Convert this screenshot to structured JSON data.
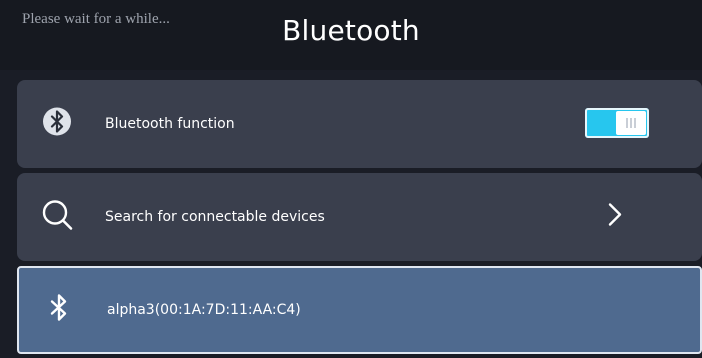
{
  "status": {
    "text": "Please wait for a while..."
  },
  "header": {
    "title": "Bluetooth"
  },
  "rows": [
    {
      "label": "Bluetooth function",
      "icon": "bluetooth-circle-icon",
      "toggle_on": true
    },
    {
      "label": "Search for connectable devices",
      "icon": "search-icon",
      "trailing_icon": "chevron-right-icon"
    },
    {
      "label": "alpha3(00:1A:7D:11:AA:C4)",
      "icon": "bluetooth-icon",
      "selected": true
    }
  ],
  "colors": {
    "accent": "#27c6ee",
    "row_bg": "#3a3f4d",
    "selected_bg": "#4f6a8f"
  }
}
